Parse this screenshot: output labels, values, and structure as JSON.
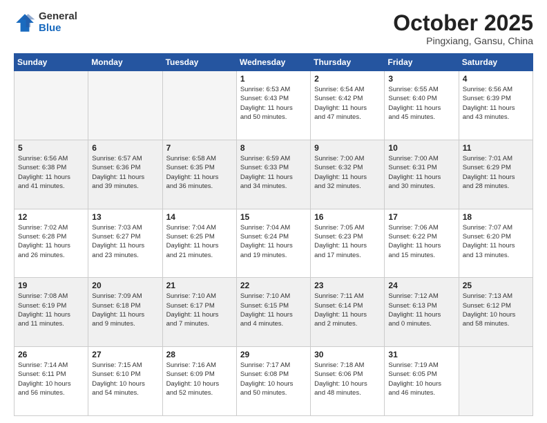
{
  "header": {
    "logo_general": "General",
    "logo_blue": "Blue",
    "month": "October 2025",
    "location": "Pingxiang, Gansu, China"
  },
  "days_of_week": [
    "Sunday",
    "Monday",
    "Tuesday",
    "Wednesday",
    "Thursday",
    "Friday",
    "Saturday"
  ],
  "weeks": [
    [
      {
        "day": "",
        "info": "",
        "empty": true
      },
      {
        "day": "",
        "info": "",
        "empty": true
      },
      {
        "day": "",
        "info": "",
        "empty": true
      },
      {
        "day": "1",
        "info": "Sunrise: 6:53 AM\nSunset: 6:43 PM\nDaylight: 11 hours\nand 50 minutes."
      },
      {
        "day": "2",
        "info": "Sunrise: 6:54 AM\nSunset: 6:42 PM\nDaylight: 11 hours\nand 47 minutes."
      },
      {
        "day": "3",
        "info": "Sunrise: 6:55 AM\nSunset: 6:40 PM\nDaylight: 11 hours\nand 45 minutes."
      },
      {
        "day": "4",
        "info": "Sunrise: 6:56 AM\nSunset: 6:39 PM\nDaylight: 11 hours\nand 43 minutes."
      }
    ],
    [
      {
        "day": "5",
        "info": "Sunrise: 6:56 AM\nSunset: 6:38 PM\nDaylight: 11 hours\nand 41 minutes.",
        "shaded": true
      },
      {
        "day": "6",
        "info": "Sunrise: 6:57 AM\nSunset: 6:36 PM\nDaylight: 11 hours\nand 39 minutes.",
        "shaded": true
      },
      {
        "day": "7",
        "info": "Sunrise: 6:58 AM\nSunset: 6:35 PM\nDaylight: 11 hours\nand 36 minutes.",
        "shaded": true
      },
      {
        "day": "8",
        "info": "Sunrise: 6:59 AM\nSunset: 6:33 PM\nDaylight: 11 hours\nand 34 minutes.",
        "shaded": true
      },
      {
        "day": "9",
        "info": "Sunrise: 7:00 AM\nSunset: 6:32 PM\nDaylight: 11 hours\nand 32 minutes.",
        "shaded": true
      },
      {
        "day": "10",
        "info": "Sunrise: 7:00 AM\nSunset: 6:31 PM\nDaylight: 11 hours\nand 30 minutes.",
        "shaded": true
      },
      {
        "day": "11",
        "info": "Sunrise: 7:01 AM\nSunset: 6:29 PM\nDaylight: 11 hours\nand 28 minutes.",
        "shaded": true
      }
    ],
    [
      {
        "day": "12",
        "info": "Sunrise: 7:02 AM\nSunset: 6:28 PM\nDaylight: 11 hours\nand 26 minutes."
      },
      {
        "day": "13",
        "info": "Sunrise: 7:03 AM\nSunset: 6:27 PM\nDaylight: 11 hours\nand 23 minutes."
      },
      {
        "day": "14",
        "info": "Sunrise: 7:04 AM\nSunset: 6:25 PM\nDaylight: 11 hours\nand 21 minutes."
      },
      {
        "day": "15",
        "info": "Sunrise: 7:04 AM\nSunset: 6:24 PM\nDaylight: 11 hours\nand 19 minutes."
      },
      {
        "day": "16",
        "info": "Sunrise: 7:05 AM\nSunset: 6:23 PM\nDaylight: 11 hours\nand 17 minutes."
      },
      {
        "day": "17",
        "info": "Sunrise: 7:06 AM\nSunset: 6:22 PM\nDaylight: 11 hours\nand 15 minutes."
      },
      {
        "day": "18",
        "info": "Sunrise: 7:07 AM\nSunset: 6:20 PM\nDaylight: 11 hours\nand 13 minutes."
      }
    ],
    [
      {
        "day": "19",
        "info": "Sunrise: 7:08 AM\nSunset: 6:19 PM\nDaylight: 11 hours\nand 11 minutes.",
        "shaded": true
      },
      {
        "day": "20",
        "info": "Sunrise: 7:09 AM\nSunset: 6:18 PM\nDaylight: 11 hours\nand 9 minutes.",
        "shaded": true
      },
      {
        "day": "21",
        "info": "Sunrise: 7:10 AM\nSunset: 6:17 PM\nDaylight: 11 hours\nand 7 minutes.",
        "shaded": true
      },
      {
        "day": "22",
        "info": "Sunrise: 7:10 AM\nSunset: 6:15 PM\nDaylight: 11 hours\nand 4 minutes.",
        "shaded": true
      },
      {
        "day": "23",
        "info": "Sunrise: 7:11 AM\nSunset: 6:14 PM\nDaylight: 11 hours\nand 2 minutes.",
        "shaded": true
      },
      {
        "day": "24",
        "info": "Sunrise: 7:12 AM\nSunset: 6:13 PM\nDaylight: 11 hours\nand 0 minutes.",
        "shaded": true
      },
      {
        "day": "25",
        "info": "Sunrise: 7:13 AM\nSunset: 6:12 PM\nDaylight: 10 hours\nand 58 minutes.",
        "shaded": true
      }
    ],
    [
      {
        "day": "26",
        "info": "Sunrise: 7:14 AM\nSunset: 6:11 PM\nDaylight: 10 hours\nand 56 minutes."
      },
      {
        "day": "27",
        "info": "Sunrise: 7:15 AM\nSunset: 6:10 PM\nDaylight: 10 hours\nand 54 minutes."
      },
      {
        "day": "28",
        "info": "Sunrise: 7:16 AM\nSunset: 6:09 PM\nDaylight: 10 hours\nand 52 minutes."
      },
      {
        "day": "29",
        "info": "Sunrise: 7:17 AM\nSunset: 6:08 PM\nDaylight: 10 hours\nand 50 minutes."
      },
      {
        "day": "30",
        "info": "Sunrise: 7:18 AM\nSunset: 6:06 PM\nDaylight: 10 hours\nand 48 minutes."
      },
      {
        "day": "31",
        "info": "Sunrise: 7:19 AM\nSunset: 6:05 PM\nDaylight: 10 hours\nand 46 minutes."
      },
      {
        "day": "",
        "info": "",
        "empty": true
      }
    ]
  ]
}
